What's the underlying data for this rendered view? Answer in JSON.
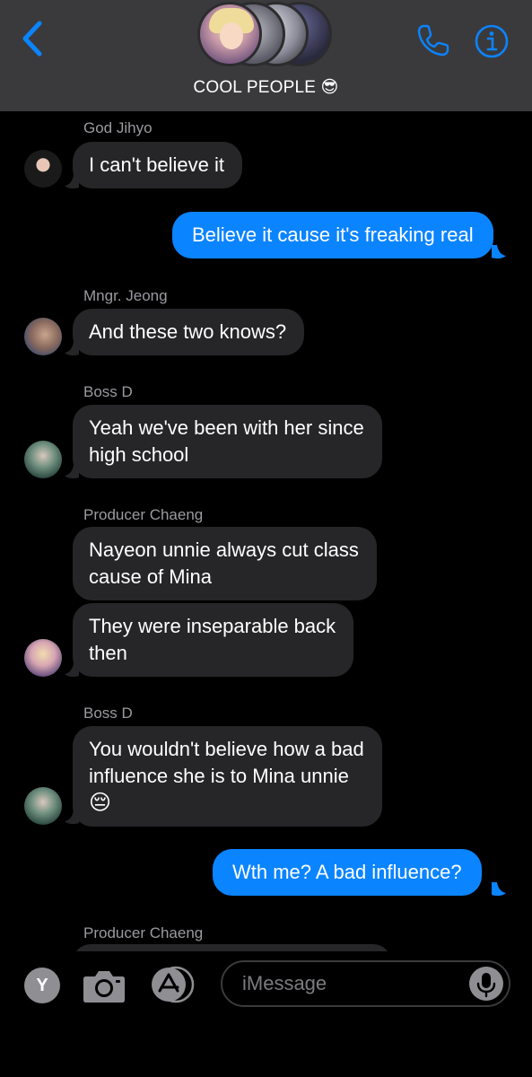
{
  "header": {
    "group_name": "COOL PEOPLE 😎",
    "accent_color": "#0b84ff"
  },
  "messages": [
    {
      "sender": "God Jihyo",
      "direction": "incoming",
      "lines": [
        "I can't believe it"
      ]
    },
    {
      "direction": "outgoing",
      "lines": [
        "Believe it cause it's freaking real"
      ]
    },
    {
      "sender": "Mngr. Jeong",
      "direction": "incoming",
      "lines": [
        "And these two knows?"
      ]
    },
    {
      "sender": "Boss D",
      "direction": "incoming",
      "lines": [
        "Yeah we've been with her since",
        "high school"
      ]
    },
    {
      "sender": "Producer Chaeng",
      "direction": "incoming",
      "lines": [
        "Nayeon unnie always cut class",
        "cause of Mina"
      ]
    },
    {
      "direction": "incoming",
      "lines": [
        "They were inseparable back",
        "then"
      ]
    },
    {
      "sender": "Boss D",
      "direction": "incoming",
      "lines": [
        "You wouldn't believe how a bad",
        "influence she is to Mina unnie"
      ],
      "emoji": "😔"
    },
    {
      "direction": "outgoing",
      "lines": [
        "Wth me? A bad influence?"
      ]
    },
    {
      "sender": "Producer Chaeng",
      "direction": "incoming",
      "lines": []
    }
  ],
  "inputbar": {
    "apps_letter": "Y",
    "placeholder": "iMessage"
  }
}
